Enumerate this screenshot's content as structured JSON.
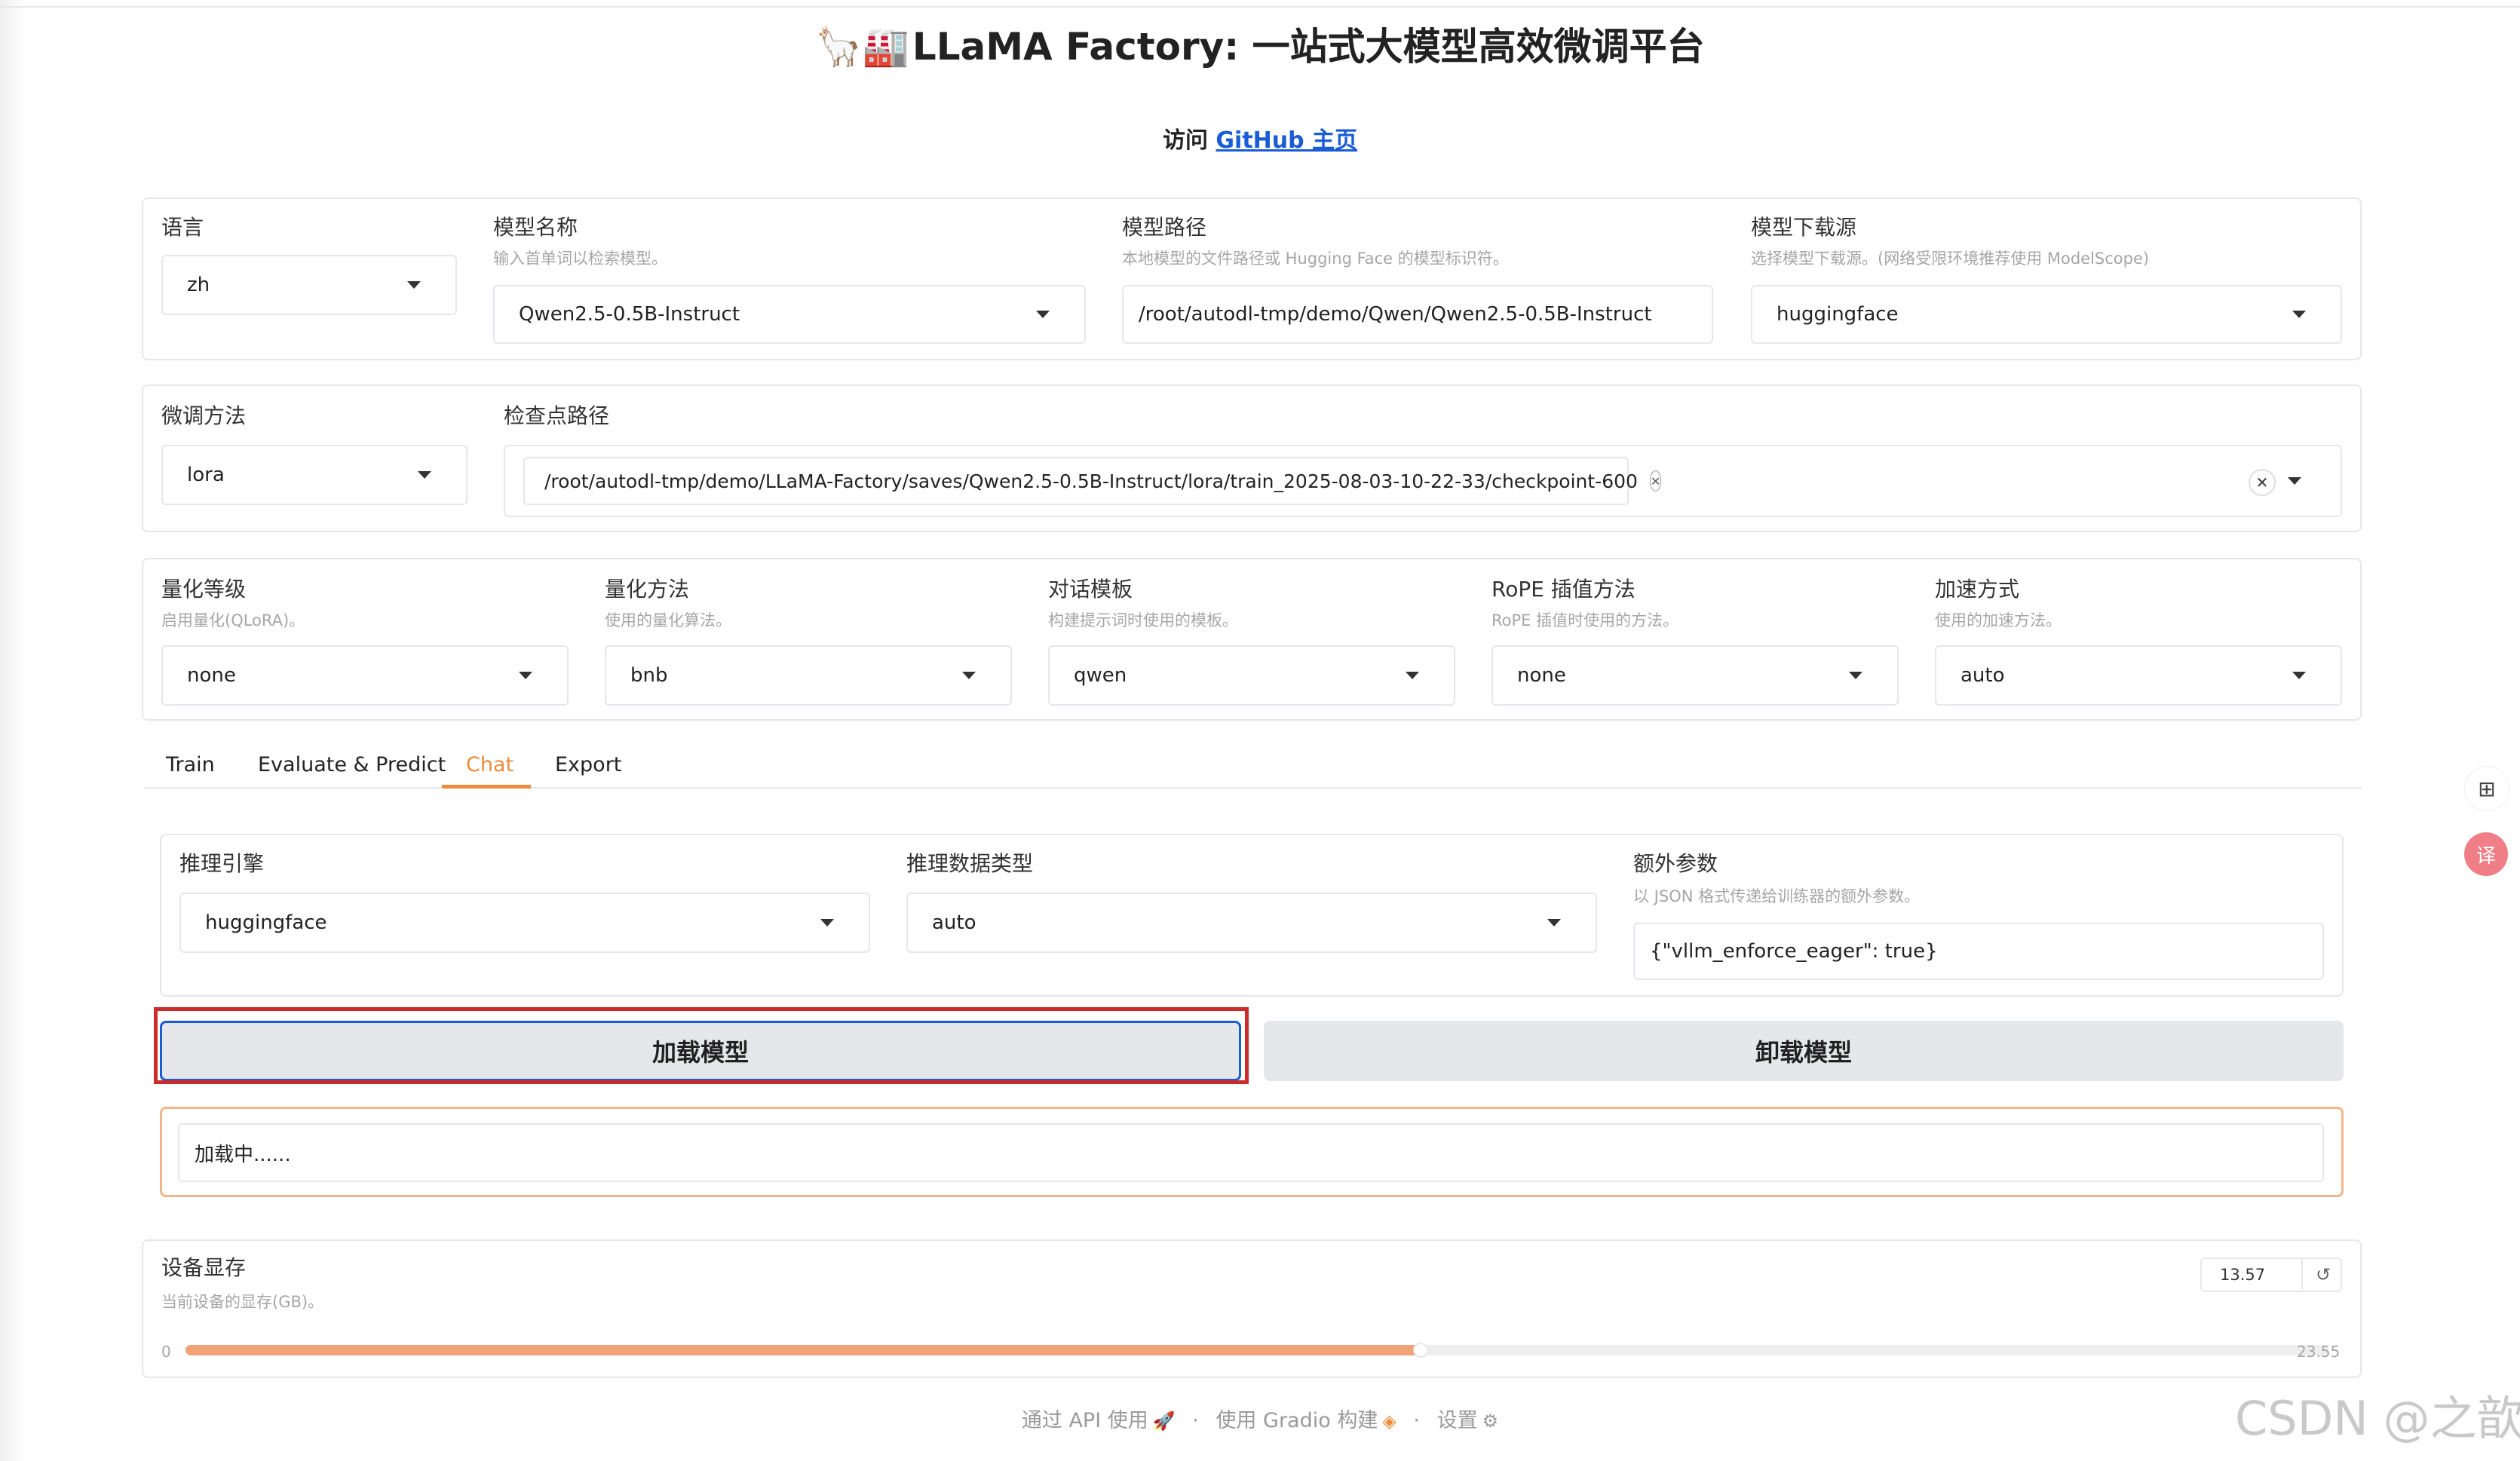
{
  "header": {
    "title_emoji": "🦙🏭",
    "title": "LLaMA Factory: 一站式大模型高效微调平台",
    "visit_prefix": "访问 ",
    "visit_link": "GitHub 主页"
  },
  "model_panel": {
    "language": {
      "label": "语言",
      "value": "zh"
    },
    "model_name": {
      "label": "模型名称",
      "hint": "输入首单词以检索模型。",
      "value": "Qwen2.5-0.5B-Instruct"
    },
    "model_path": {
      "label": "模型路径",
      "hint": "本地模型的文件路径或 Hugging Face 的模型标识符。",
      "value": "/root/autodl-tmp/demo/Qwen/Qwen2.5-0.5B-Instruct"
    },
    "model_source": {
      "label": "模型下载源",
      "hint": "选择模型下载源。(网络受限环境推荐使用 ModelScope)",
      "value": "huggingface"
    }
  },
  "finetune_panel": {
    "method": {
      "label": "微调方法",
      "value": "lora"
    },
    "checkpoint": {
      "label": "检查点路径",
      "value": "/root/autodl-tmp/demo/LLaMA-Factory/saves/Qwen2.5-0.5B-Instruct/lora/train_2025-08-03-10-22-33/checkpoint-600"
    }
  },
  "advanced_panel": {
    "quant_bit": {
      "label": "量化等级",
      "hint": "启用量化(QLoRA)。",
      "value": "none"
    },
    "quant_method": {
      "label": "量化方法",
      "hint": "使用的量化算法。",
      "value": "bnb"
    },
    "template": {
      "label": "对话模板",
      "hint": "构建提示词时使用的模板。",
      "value": "qwen"
    },
    "rope": {
      "label": "RoPE 插值方法",
      "hint": "RoPE 插值时使用的方法。",
      "value": "none"
    },
    "booster": {
      "label": "加速方式",
      "hint": "使用的加速方法。",
      "value": "auto"
    }
  },
  "tabs": [
    {
      "label": "Train"
    },
    {
      "label": "Evaluate & Predict"
    },
    {
      "label": "Chat",
      "active": true
    },
    {
      "label": "Export"
    }
  ],
  "chat_panel": {
    "infer_backend": {
      "label": "推理引擎",
      "value": "huggingface"
    },
    "infer_dtype": {
      "label": "推理数据类型",
      "value": "auto"
    },
    "extra_args": {
      "label": "额外参数",
      "hint": "以 JSON 格式传递给训练器的额外参数。",
      "value": "{\"vllm_enforce_eager\": true}"
    }
  },
  "buttons": {
    "load": "加载模型",
    "unload": "卸载模型"
  },
  "status": {
    "text": "加载中......"
  },
  "memory": {
    "label": "设备显存",
    "hint": "当前设备的显存(GB)。",
    "value": "13.57",
    "value_num": 13.57,
    "min": "0",
    "max": "23.55",
    "max_num": 23.55
  },
  "footer": {
    "api": "通过 API 使用",
    "gradio": "使用 Gradio 构建",
    "settings": "设置",
    "dot": "·"
  },
  "watermark": "CSDN @之歆",
  "colors": {
    "accent": "#f08a3a",
    "highlight": "#cc2b2b",
    "link": "#1a5bd6",
    "slider_fill": "#f2a277"
  }
}
